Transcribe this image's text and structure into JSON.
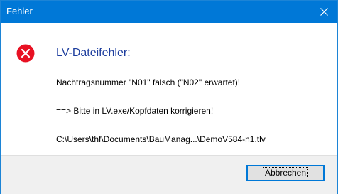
{
  "window": {
    "title": "Fehler",
    "title_bar_color": "#0078d7"
  },
  "close_button": {
    "icon": "close-icon"
  },
  "message": {
    "icon": "error-icon",
    "icon_color": "#e81123",
    "heading": "LV-Dateifehler:",
    "line1": "Nachtragsnummer \"N01\" falsch (\"N02\" erwartet)!",
    "line2": "==> Bitte in LV.exe/Kopfdaten korrigieren!",
    "line3": "C:\\Users\\thf\\Documents\\BauManag...\\DemoV584-n1.tlv"
  },
  "footer": {
    "cancel_label": "Abbrechen"
  }
}
